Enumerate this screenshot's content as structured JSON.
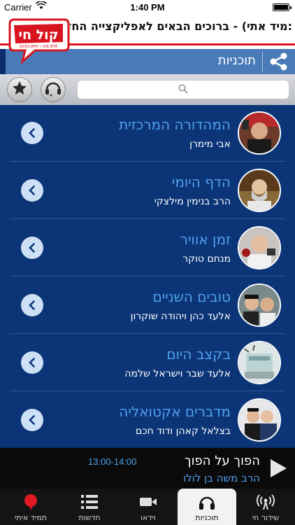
{
  "status": {
    "carrier": "Carrier",
    "time": "1:40 PM"
  },
  "ticker": ":מיד אתי) - ברוכים הבאים לאפליקצייה החדשה",
  "logo": {
    "wordmark": "קול חי",
    "tag": "תמיד איתי",
    "freq": "93/92.8FM • 106.5FM"
  },
  "title_bar": {
    "title": "תוכניות",
    "share_icon": "share-icon"
  },
  "toolbar": {
    "search_placeholder": "",
    "left_icons": [
      "star-icon",
      "headset-chat-icon"
    ]
  },
  "programs": [
    {
      "name": "המהדורה המרכזית",
      "host": "אבי מימרן"
    },
    {
      "name": "הדף היומי",
      "host": "הרב בנימין מילצקי"
    },
    {
      "name": "זמן אוויר",
      "host": "מנחם טוקר"
    },
    {
      "name": "טובים השניים",
      "host": "אלעד כהן ויהודה שוקרון"
    },
    {
      "name": "בקצב היום",
      "host": "אלעד שבר וישראל שלמה"
    },
    {
      "name": "מדברים אקטואליה",
      "host": "בצלאל קאהן ודוד חכם"
    }
  ],
  "now_playing": {
    "show": "הפוך על הפוך",
    "host": "הרב משה בן לולו",
    "hours": "13:00-14:00"
  },
  "tabs": [
    {
      "label": "שידור חי",
      "icon": "broadcast-icon"
    },
    {
      "label": "תוכניות",
      "icon": "headphones-icon"
    },
    {
      "label": "וידאו",
      "icon": "video-camera-icon"
    },
    {
      "label": "חדשות",
      "icon": "list-icon"
    },
    {
      "label": "תמיד איתי",
      "icon": "red-bubble-icon"
    }
  ],
  "colors": {
    "accent_blue": "#4fa0ee",
    "title_bar": "#4a7bb8",
    "list_bg": "#0c3577",
    "brand_red": "#d8141f"
  }
}
